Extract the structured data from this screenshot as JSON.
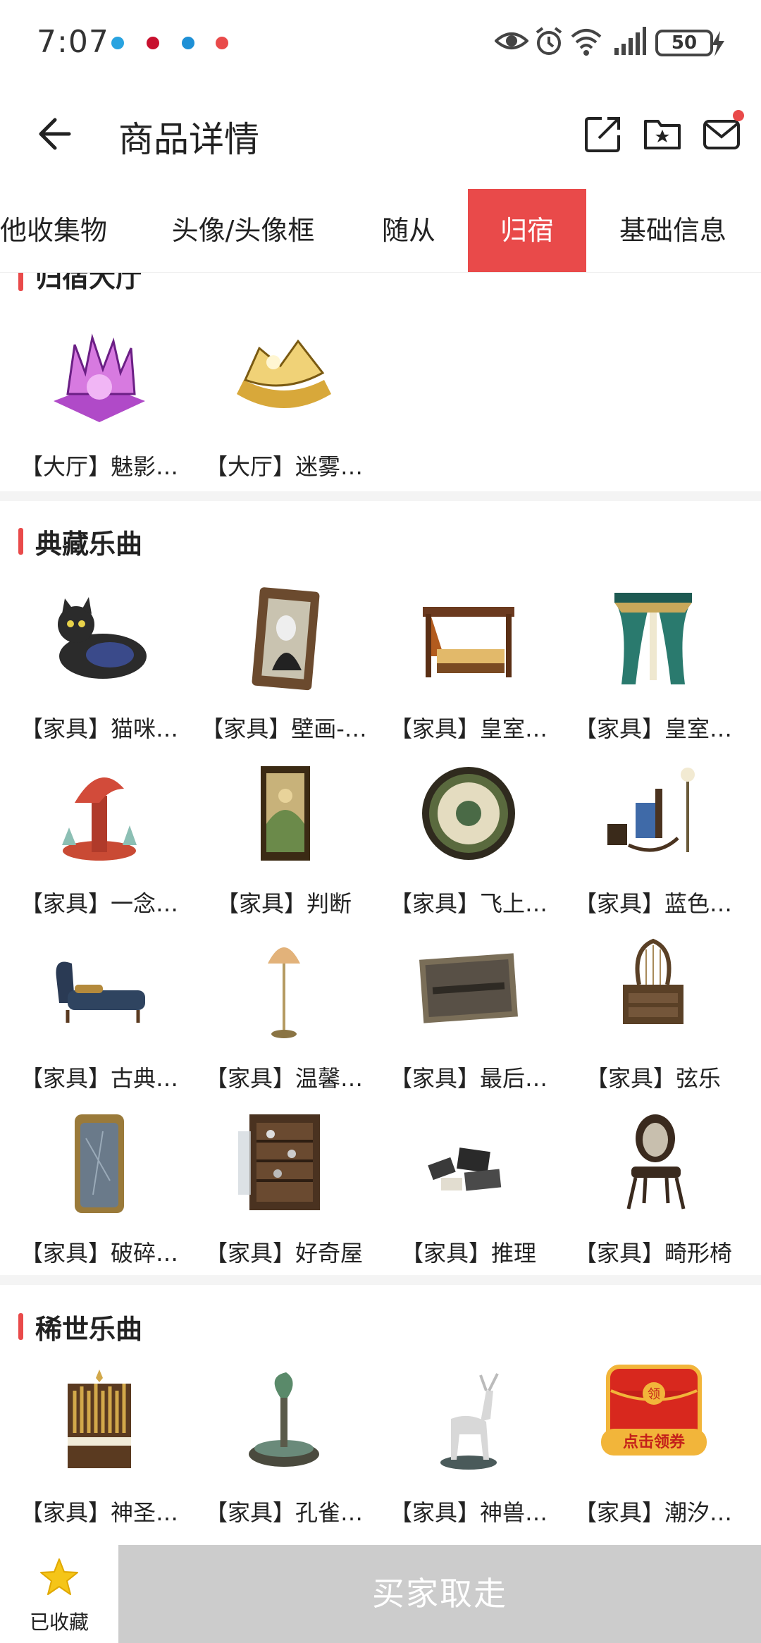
{
  "status_bar": {
    "time": "7:07",
    "battery": "50"
  },
  "header": {
    "title": "商品详情"
  },
  "tabs": [
    {
      "label": "他收集物"
    },
    {
      "label": "头像/头像框"
    },
    {
      "label": "随从"
    },
    {
      "label": "归宿",
      "active": true
    },
    {
      "label": "基础信息"
    }
  ],
  "sections": {
    "lobby": {
      "title": "归宿大厅",
      "items": [
        {
          "label": "【大厅】魅影…",
          "icon": "purple-castle-book"
        },
        {
          "label": "【大厅】迷雾…",
          "icon": "golden-mist-book"
        }
      ]
    },
    "classic": {
      "title": "典藏乐曲",
      "items": [
        {
          "label": "【家具】猫咪…",
          "icon": "black-cat-sofa"
        },
        {
          "label": "【家具】壁画-…",
          "icon": "portrait-painting"
        },
        {
          "label": "【家具】皇室…",
          "icon": "royal-bed"
        },
        {
          "label": "【家具】皇室…",
          "icon": "royal-curtain"
        },
        {
          "label": "【家具】一念…",
          "icon": "tree-ornament"
        },
        {
          "label": "【家具】判断",
          "icon": "tapestry"
        },
        {
          "label": "【家具】飞上…",
          "icon": "round-rug"
        },
        {
          "label": "【家具】蓝色…",
          "icon": "blue-rocking-chair"
        },
        {
          "label": "【家具】古典…",
          "icon": "chaise-lounge"
        },
        {
          "label": "【家具】温馨…",
          "icon": "floor-lamp"
        },
        {
          "label": "【家具】最后…",
          "icon": "last-supper-painting"
        },
        {
          "label": "【家具】弦乐",
          "icon": "harp-dresser"
        },
        {
          "label": "【家具】破碎…",
          "icon": "broken-mirror"
        },
        {
          "label": "【家具】好奇屋",
          "icon": "curio-cabinet"
        },
        {
          "label": "【家具】推理",
          "icon": "scattered-books"
        },
        {
          "label": "【家具】畸形椅",
          "icon": "twisted-chair"
        }
      ]
    },
    "rare": {
      "title": "稀世乐曲",
      "items": [
        {
          "label": "【家具】神圣…",
          "icon": "organ"
        },
        {
          "label": "【家具】孔雀…",
          "icon": "peacock-fountain"
        },
        {
          "label": "【家具】神兽…",
          "icon": "deer-statue"
        },
        {
          "label": "【家具】潮汐…",
          "icon": "red-envelope"
        }
      ]
    }
  },
  "promo": {
    "top": "领",
    "bottom": "点击领券"
  },
  "bottom_bar": {
    "favorite_label": "已收藏",
    "buy_label": "买家取走"
  },
  "colors": {
    "accent": "#e94a4a",
    "buy_disabled": "#cccccc",
    "star": "#f5c518"
  }
}
